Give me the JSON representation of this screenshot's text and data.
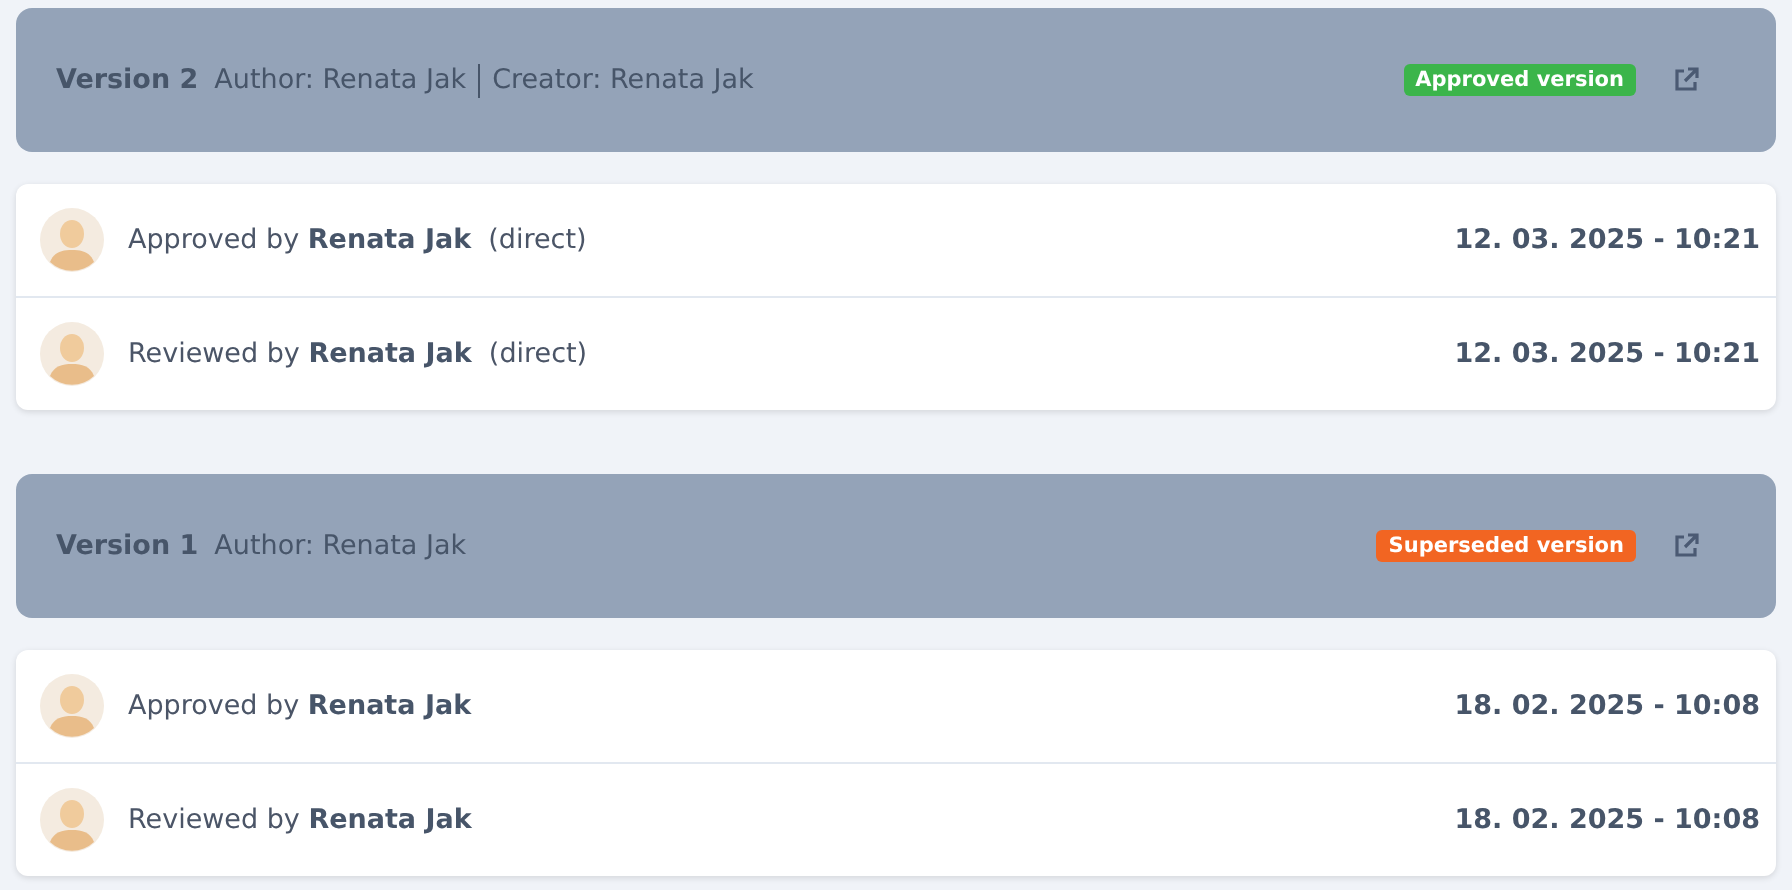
{
  "versions": [
    {
      "title": "Version 2",
      "meta": [
        "Author: Renata Jak",
        "Creator: Renata Jak"
      ],
      "badge": {
        "label": "Approved version",
        "color": "#3bb54a"
      },
      "entries": [
        {
          "text": "Approved by **Renata Jak**  (direct)",
          "date": "12. 03. 2025 - 10:21"
        },
        {
          "text": "Reviewed by **Renata Jak**  (direct)",
          "date": "12. 03. 2025 - 10:21"
        }
      ]
    },
    {
      "title": "Version 1",
      "meta": [
        "Author: Renata Jak"
      ],
      "badge": {
        "label": "Superseded version",
        "color": "#f26522"
      },
      "entries": [
        {
          "text": "Approved by **Renata Jak**",
          "date": "18. 02. 2025 - 10:08"
        },
        {
          "text": "Reviewed by **Renata Jak**",
          "date": "18. 02. 2025 - 10:08"
        }
      ]
    }
  ]
}
